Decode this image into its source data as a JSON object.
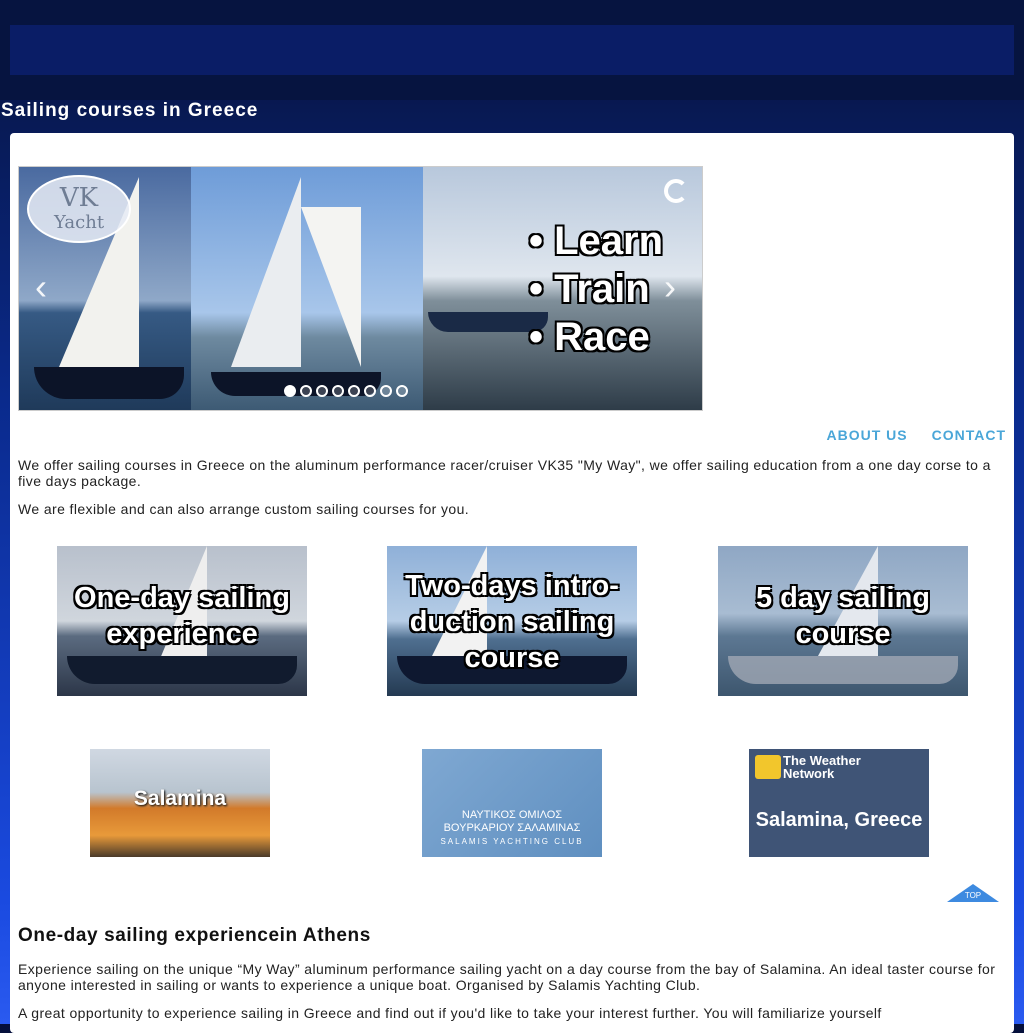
{
  "site": {
    "title": "Sailing courses in Greece"
  },
  "slider": {
    "logo_line1": "VK",
    "logo_line2": "Yacht",
    "bullets": [
      "• Learn",
      "• Train",
      "• Race"
    ],
    "prev_icon": "chevron-left-icon",
    "next_icon": "chevron-right-icon",
    "dot_count": 8,
    "active_dot": 1
  },
  "top_links": {
    "about": "ABOUT US",
    "contact": "CONTACT"
  },
  "intro": {
    "p1": "We offer sailing courses in Greece on the aluminum performance racer/cruiser VK35 \"My Way\", we offer sailing education from a one day corse to a five days package.",
    "p2": "We are flexible and can also arrange custom sailing courses for you."
  },
  "courses": [
    {
      "label": "One-day sailing experience"
    },
    {
      "label": "Two-days intro-duction sailing course"
    },
    {
      "label": "5 day sailing course"
    }
  ],
  "tiles": {
    "salamina": "Salamina",
    "club_line1": "ΝΑΥΤΙΚΟΣ ΟΜΙΛΟΣ",
    "club_line2": "ΒΟΥΡΚΑΡΙΟΥ ΣΑΛΑΜΙΝΑΣ",
    "club_line3": "SALAMIS YACHTING CLUB",
    "weather_brand": "The Weather Network",
    "weather_loc": "Salamina, Greece"
  },
  "top_button": "TOP",
  "section": {
    "title": "One-day sailing experiencein Athens",
    "p1": "Experience sailing on the unique “My Way” aluminum performance sailing yacht on a day course from the bay of Salamina. An ideal taster course for anyone interested in sailing or wants to experience a unique boat. Organised by Salamis Yachting Club.",
    "p2": "A great opportunity to experience sailing in Greece and find out if you'd like to take your interest further. You will familiarize yourself"
  },
  "colors": {
    "link": "#4aa6d8",
    "header_bg": "#061440",
    "nav_bg": "#0a1d66"
  }
}
